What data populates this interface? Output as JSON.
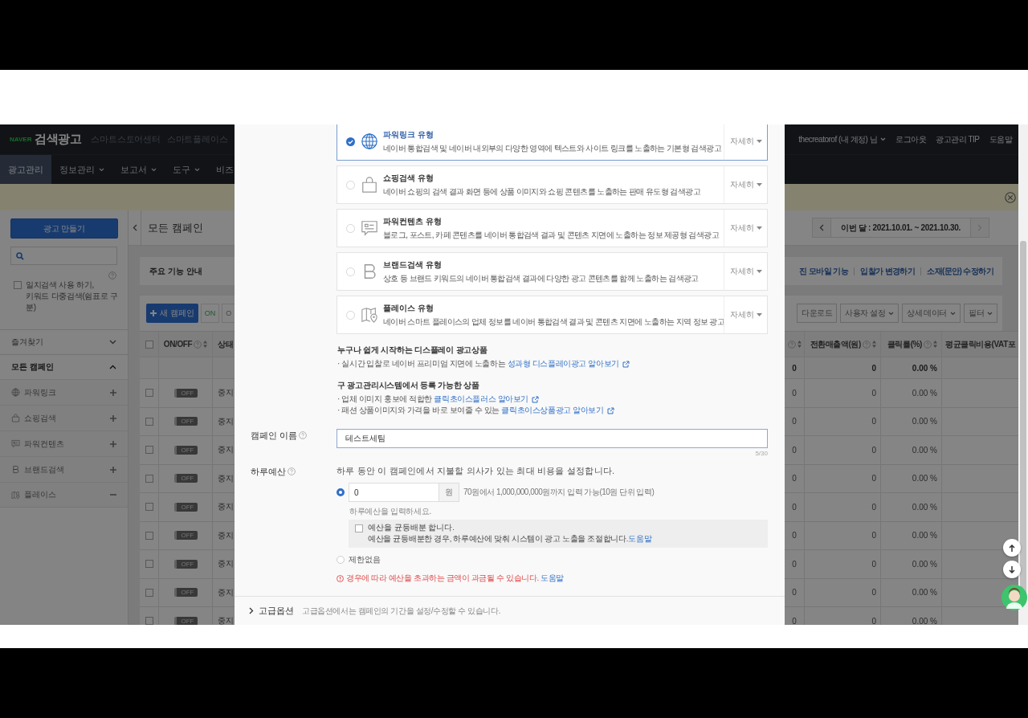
{
  "header": {
    "logo_mark": "NAVER",
    "logo_text": "검색광고",
    "links": [
      "스마트스토어센터",
      "스마트플레이스"
    ],
    "account": "thecreatorof (내 계정) 님",
    "account_links": [
      "로그아웃",
      "광고관리 TIP",
      "도움말"
    ]
  },
  "nav": [
    {
      "label": "광고관리",
      "selected": true,
      "dropdown": false
    },
    {
      "label": "정보관리",
      "selected": false,
      "dropdown": true
    },
    {
      "label": "보고서",
      "selected": false,
      "dropdown": true
    },
    {
      "label": "도구",
      "selected": false,
      "dropdown": true
    },
    {
      "label": "비즈",
      "selected": false,
      "dropdown": false
    }
  ],
  "sidebar": {
    "create_button": "광고 만들기",
    "exact_match": {
      "label": "일치검색 사용 하기,\n키워드 다중검색(쉼표로 구분)",
      "checked": false
    },
    "favorites": {
      "label": "즐겨찾기",
      "expanded": false
    },
    "campaigns": {
      "label": "모든 캠페인",
      "expanded": true,
      "items": [
        {
          "label": "파워링크",
          "kind": "globe",
          "expanded": false
        },
        {
          "label": "쇼핑검색",
          "kind": "bag",
          "expanded": false
        },
        {
          "label": "파워컨텐츠",
          "kind": "chat",
          "expanded": false
        },
        {
          "label": "브랜드검색",
          "kind": "brand",
          "expanded": false
        },
        {
          "label": "플레이스",
          "kind": "map",
          "expanded": true
        }
      ]
    }
  },
  "main": {
    "title": "모든 캠페인",
    "date_range": "이번 달 : 2021.10.01. ~ 2021.10.30.",
    "guide_title": "주요 기능 안내",
    "guide_links": [
      "진 모바일 기능",
      "입찰가 변경하기",
      "소재(문안) 수정하기"
    ],
    "new_campaign_button": "새 캠페인",
    "filter_buttons": [
      "ON",
      "O"
    ],
    "toolbar_buttons": [
      {
        "label": "다운로드",
        "dropdown": false
      },
      {
        "label": "사용자 설정",
        "dropdown": true
      },
      {
        "label": "상세 데이터",
        "dropdown": true
      },
      {
        "label": "필터",
        "dropdown": true
      }
    ]
  },
  "table": {
    "all_checked": false,
    "left_columns": [
      {
        "label": "ON/OFF",
        "help": true,
        "sortable": true
      },
      {
        "label": "상태"
      }
    ],
    "right_columns": [
      {
        "help": true,
        "sortable": true
      },
      {
        "label": "전환매출액(원)",
        "help": true,
        "sortable": true
      },
      {
        "label": "클릭률(%)",
        "help": true,
        "sortable": true
      },
      {
        "label": "평균클릭비용(VAT포"
      }
    ],
    "summary": [
      "0",
      "0",
      "0.00 %"
    ],
    "rows": [
      {
        "checked": false,
        "on": false,
        "toggle": "OFF",
        "status": "중지",
        "cells": [
          "0",
          "0",
          "0.00 %"
        ]
      },
      {
        "checked": false,
        "on": false,
        "toggle": "OFF",
        "status": "중지",
        "cells": [
          "0",
          "0",
          "0.00 %"
        ]
      },
      {
        "checked": false,
        "on": false,
        "toggle": "OFF",
        "status": "중지",
        "cells": [
          "0",
          "0",
          "0.00 %"
        ]
      },
      {
        "checked": false,
        "on": false,
        "toggle": "OFF",
        "status": "중지",
        "cells": [
          "0",
          "0",
          "0.00 %"
        ]
      },
      {
        "checked": false,
        "on": false,
        "toggle": "OFF",
        "status": "중지",
        "cells": [
          "0",
          "0",
          "0.00 %"
        ]
      },
      {
        "checked": false,
        "on": false,
        "toggle": "OFF",
        "status": "중지",
        "cells": [
          "0",
          "0",
          "0.00 %"
        ]
      },
      {
        "checked": false,
        "on": false,
        "toggle": "OFF",
        "status": "중지",
        "cells": [
          "0",
          "0",
          "0.00 %"
        ]
      },
      {
        "checked": false,
        "on": false,
        "toggle": "OFF",
        "status": "중지",
        "cells": [
          "0",
          "0",
          "0.00 %"
        ]
      },
      {
        "checked": false,
        "on": false,
        "toggle": "OFF",
        "status": "중지",
        "cells": [
          "0",
          "0",
          "0.00 %"
        ]
      }
    ]
  },
  "modal": {
    "ad_types": [
      {
        "kind": "globe",
        "title": "파워링크 유형",
        "description": "네이버 통합검색 및 네이버 내외부의 다양한 영역에 텍스트와 사이트 링크를 노출하는 기본형 검색광고",
        "more": "자세히",
        "selected": true
      },
      {
        "kind": "bag",
        "title": "쇼핑검색 유형",
        "description": "네이버 쇼핑의 검색 결과 화면 등에 상품 이미지와 쇼핑 콘텐츠를 노출하는 판매 유도형 검색광고",
        "more": "자세히",
        "selected": false
      },
      {
        "kind": "chat",
        "title": "파워컨텐츠 유형",
        "description": "블로그, 포스트, 카페 콘텐츠를 네이버 통합검색 결과 및 콘텐츠 지면에 노출하는 정보 제공형 검색광고",
        "more": "자세히",
        "selected": false
      },
      {
        "kind": "brand",
        "title": "브랜드검색 유형",
        "description": "상호 등 브랜드 키워드의 네이버 통합검색 결과에 다양한 광고 콘텐츠를 함께 노출하는 검색광고",
        "more": "자세히",
        "selected": false
      },
      {
        "kind": "map",
        "title": "플레이스 유형",
        "description": "네이버 스마트 플레이스의 업체 정보를 네이버 통합검색 결과 및 콘텐츠 지면에 노출하는 지역 정보 광고",
        "more": "자세히",
        "selected": false
      }
    ],
    "sections": [
      {
        "title": "누구나 쉽게 시작하는 디스플레이 광고상품",
        "items": [
          {
            "text": "· 실시간 입찰로 네이버 프리미엄 지면에 노출하는 ",
            "link": "성과형 디스플레이광고 알아보기"
          }
        ]
      },
      {
        "title": "구 광고관리시스템에서 등록 가능한 상품",
        "items": [
          {
            "text": "· 업체 이미지 홍보에 적합한 ",
            "link": "클릭초이스플러스 알아보기"
          },
          {
            "text": "· 패션 상품이미지와 가격을 바로 보여줄 수 있는 ",
            "link": "클릭초이스상품광고 알아보기"
          }
        ]
      }
    ],
    "campaign_name": {
      "label": "캠페인 이름",
      "value": "테스트세팀",
      "counter": "5/30"
    },
    "daily_budget": {
      "label": "하루예산",
      "description": "하루 동안 이 캠페인에서 지불할 의사가 있는 최대 비용을 설정합니다.",
      "amount": {
        "selected": true,
        "value": "0",
        "unit": "원",
        "hint": "70원에서 1,000,000,000원까지 입력 가능(10원 단위 입력)",
        "error": "하루예산을 입력하세요."
      },
      "even_distribution": {
        "label": "예산을 균등배분 합니다.",
        "checked": false,
        "description": "예산을 균등배분한 경우, 하루예산에 맞춰 시스템이 광고 노출을 조절합니다.",
        "link": "도움말"
      },
      "unlimited": {
        "label": "제한없음",
        "selected": false
      },
      "warning": {
        "text": "경우에 따라 예산을 초과하는 금액이 과금될 수 있습니다. ",
        "link": "도움말"
      }
    },
    "advanced": {
      "label": "고급옵션",
      "description": "고급옵션에서는 캠페인의 기간을 설정/수정할 수 있습니다.",
      "expanded": false
    }
  }
}
